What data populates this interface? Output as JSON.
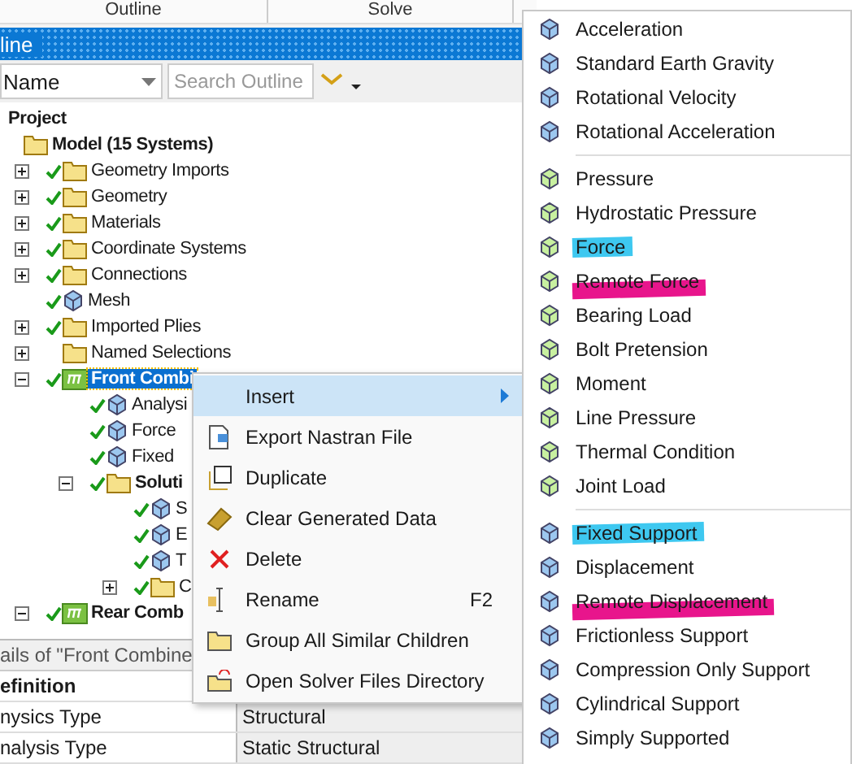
{
  "top_tabs": [
    "Outline",
    "Solve"
  ],
  "panel_title": "line",
  "filter": {
    "field": "Name",
    "placeholder": "Search Outline"
  },
  "tree": [
    {
      "label": "Project",
      "bold": true,
      "children": [
        {
          "label": "Model (15 Systems)",
          "bold": true,
          "children": [
            {
              "label": "Geometry Imports",
              "checked": true,
              "expanded": false
            },
            {
              "label": "Geometry",
              "checked": true,
              "expanded": false
            },
            {
              "label": "Materials",
              "checked": true,
              "expanded": false
            },
            {
              "label": "Coordinate Systems",
              "checked": true,
              "expanded": false
            },
            {
              "label": "Connections",
              "checked": true,
              "expanded": false
            },
            {
              "label": "Mesh",
              "checked": true
            },
            {
              "label": "Imported Plies",
              "checked": true,
              "expanded": false
            },
            {
              "label": "Named Selections",
              "checked": false,
              "expanded": false
            },
            {
              "label": "Front Combi",
              "bold": true,
              "selected": true,
              "checked": true,
              "expanded": true,
              "children": [
                {
                  "label": "Analysi",
                  "checked": true
                },
                {
                  "label": "Force",
                  "checked": true
                },
                {
                  "label": "Fixed",
                  "checked": true
                },
                {
                  "label": "Soluti",
                  "bold": true,
                  "checked": true,
                  "expanded": true,
                  "children": [
                    {
                      "label": "S",
                      "checked": true
                    },
                    {
                      "label": "E",
                      "checked": true
                    },
                    {
                      "label": "T",
                      "checked": true
                    },
                    {
                      "label": "C",
                      "checked": true,
                      "expanded": false
                    }
                  ]
                }
              ]
            },
            {
              "label": "Rear Comb",
              "bold": true,
              "selected": false,
              "checked": true,
              "expanded": true
            }
          ]
        }
      ]
    }
  ],
  "details": {
    "title": "ails of \"Front Combine",
    "section": "efinition",
    "rows": [
      {
        "name": "nysics Type",
        "value": "Structural"
      },
      {
        "name": "nalysis Type",
        "value": "Static Structural"
      }
    ]
  },
  "context_menu": [
    {
      "label": "Insert",
      "selected": true,
      "submenu": true
    },
    {
      "label": "Export Nastran File",
      "selected": false
    },
    {
      "label": "Duplicate",
      "selected": false
    },
    {
      "label": "Clear Generated Data",
      "selected": false
    },
    {
      "label": "Delete",
      "selected": false
    },
    {
      "label": "Rename",
      "shortcut": "F2",
      "selected": false
    },
    {
      "label": "Group All Similar Children",
      "selected": false
    },
    {
      "label": "Open Solver Files Directory",
      "selected": false
    }
  ],
  "submenu": [
    [
      {
        "label": "Acceleration"
      },
      {
        "label": "Standard Earth Gravity"
      },
      {
        "label": "Rotational Velocity"
      },
      {
        "label": "Rotational Acceleration"
      }
    ],
    [
      {
        "label": "Pressure"
      },
      {
        "label": "Hydrostatic Pressure"
      },
      {
        "label": "Force",
        "color": "#3ec8f0"
      },
      {
        "label": "Remote Force",
        "color": "#e8158c"
      },
      {
        "label": "Bearing Load"
      },
      {
        "label": "Bolt Pretension"
      },
      {
        "label": "Moment"
      },
      {
        "label": "Line Pressure"
      },
      {
        "label": "Thermal Condition"
      },
      {
        "label": "Joint Load"
      }
    ],
    [
      {
        "label": "Fixed Support",
        "color": "#3ec8f0"
      },
      {
        "label": "Displacement"
      },
      {
        "label": "Remote Displacement",
        "color": "#e8158c"
      },
      {
        "label": "Frictionless Support"
      },
      {
        "label": "Compression Only Support"
      },
      {
        "label": "Cylindrical Support"
      },
      {
        "label": "Simply Supported"
      }
    ]
  ]
}
